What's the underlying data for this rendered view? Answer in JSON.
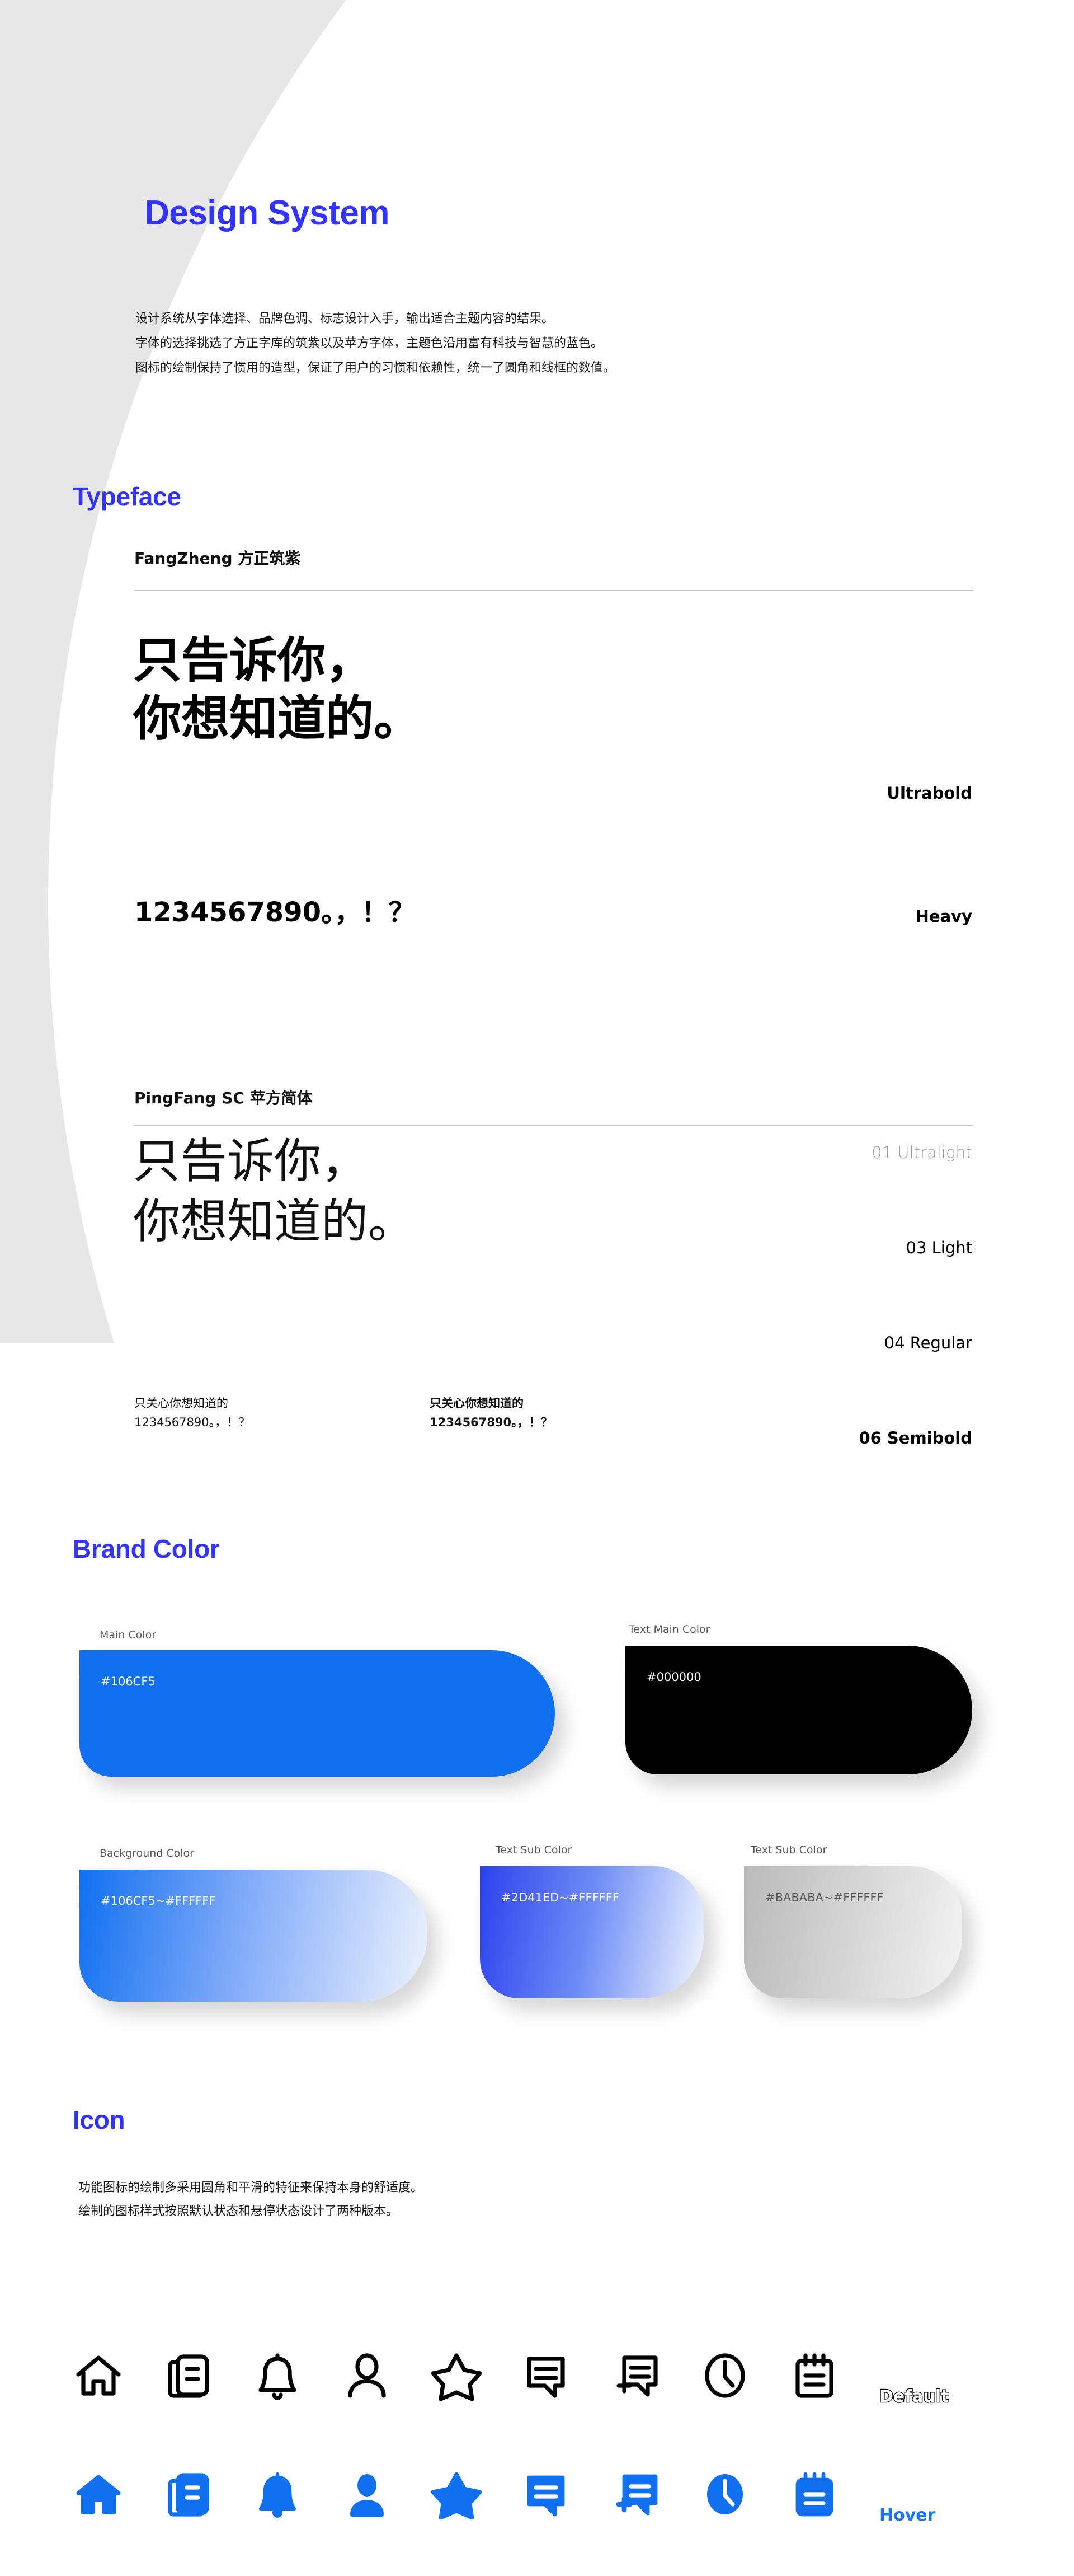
{
  "page": {
    "background_color": "#E7E7E7",
    "sheet_color": "#FFFFFF",
    "accent_color": "#3333FF",
    "icon_accent_color": "#1070F0"
  },
  "header": {
    "title": "Design System",
    "intro": "设计系统从字体选择、品牌色调、标志设计入手，输出适合主题内容的结果。\n字体的选择挑选了方正字库的筑紫以及苹方字体，主题色沿用富有科技与智慧的蓝色。\n图标的绘制保持了惯用的造型，保证了用户的习惯和依赖性，统一了圆角和线框的数值。"
  },
  "sections": {
    "typeface": {
      "heading": "Typeface",
      "families": [
        {
          "name": "FangZheng 方正筑紫",
          "sample_lines": "只告诉你，\n你想知道的。",
          "sample_numbers": "1234567890。，！？",
          "weights": [
            "Ultrabold",
            "Heavy"
          ]
        },
        {
          "name": "PingFang SC 苹方简体",
          "sample_lines": "只告诉你，\n你想知道的。",
          "small_samples": [
            "只关心你想知道的\n1234567890。，！？",
            "只关心你想知道的\n1234567890。，！？"
          ],
          "weights": [
            "01 Ultralight",
            "03 Light",
            "04 Regular",
            "06 Semibold"
          ]
        }
      ]
    },
    "brand_color": {
      "heading": "Brand Color",
      "swatches": [
        {
          "label": "Main Color",
          "value": "#106CF5",
          "fill": "#1070F0",
          "text": "#FFFFFF"
        },
        {
          "label": "Text Main Color",
          "value": "#000000",
          "fill": "#000000",
          "text": "#FFFFFF"
        },
        {
          "label": "Background Color",
          "value": "#106CF5~#FFFFFF",
          "from": "#1070F0",
          "to": "#FFFFFF",
          "text": "#FFFFFF"
        },
        {
          "label": "Text Sub Color",
          "value": "#2D41ED~#FFFFFF",
          "from": "#2D41ED",
          "to": "#FFFFFF",
          "text": "#FFFFFF"
        },
        {
          "label": "Text Sub Color",
          "value": "#BABABA~#FFFFFF",
          "from": "#BABABA",
          "to": "#FFFFFF",
          "text": "#585858"
        }
      ]
    },
    "icon": {
      "heading": "Icon",
      "intro": "功能图标的绘制多采用圆角和平滑的特征来保持本身的舒适度。\n绘制的图标样式按照默认状态和悬停状态设计了两种版本。",
      "states": {
        "default_label": "Default",
        "hover_label": "Hover"
      },
      "icons": [
        "home-icon",
        "book-icon",
        "bell-icon",
        "user-icon",
        "star-icon",
        "comment-icon",
        "add-comment-icon",
        "clock-icon",
        "notepad-icon"
      ]
    }
  }
}
